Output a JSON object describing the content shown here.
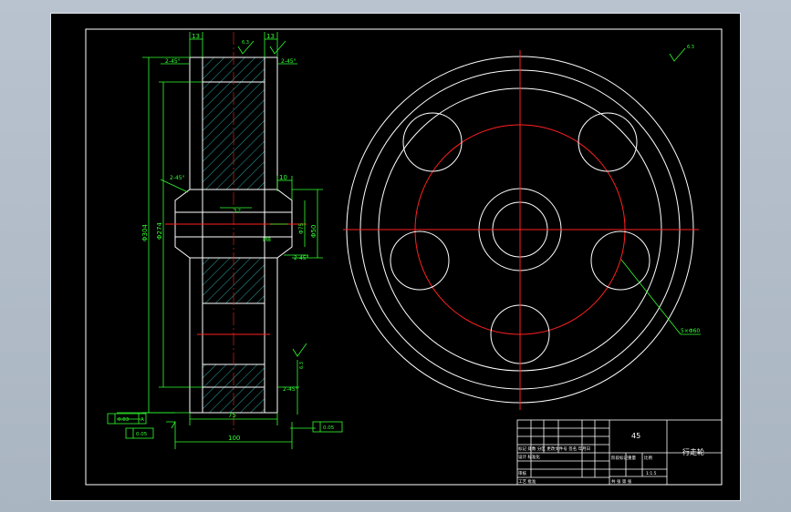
{
  "dims": {
    "w_left": "13",
    "w_right": "13",
    "bore_chamfer": "10",
    "hub_width": "75",
    "overall_width": "100",
    "dia_outer": "Φ304",
    "dia_inner": "Φ274",
    "dia_shaft": "Φ50",
    "dia_hub": "Φ75",
    "key_depth": "M8"
  },
  "chamfers": {
    "c1": "2-45°",
    "c2": "2-45°",
    "c3": "2-45°",
    "c4": "2-45°",
    "c5": "2-45°"
  },
  "roughness": {
    "r1": "6.3",
    "r2": "6.3",
    "r3": "3.2",
    "corner": "6.3"
  },
  "tolerance": {
    "t1": "0.03",
    "t2": "A",
    "t3": "0.05"
  },
  "holes_label": "5×Φ60",
  "title_block": {
    "material": "45",
    "part_name": "行走轮",
    "scale": "1:1.5",
    "row1": "标记  处数  分区  更改文件号  签名  年月日",
    "row2": "设计        标准化",
    "row3": "审核",
    "row4": "工艺        批准",
    "stage": "阶段标记",
    "weight": "重量",
    "ratio": "比例",
    "sheet": "共 张  第 张"
  },
  "colors": {
    "outline": "#ffffff",
    "dimension": "#30ff30",
    "centerline": "#ff2020",
    "hatch": "#30d0d0"
  }
}
